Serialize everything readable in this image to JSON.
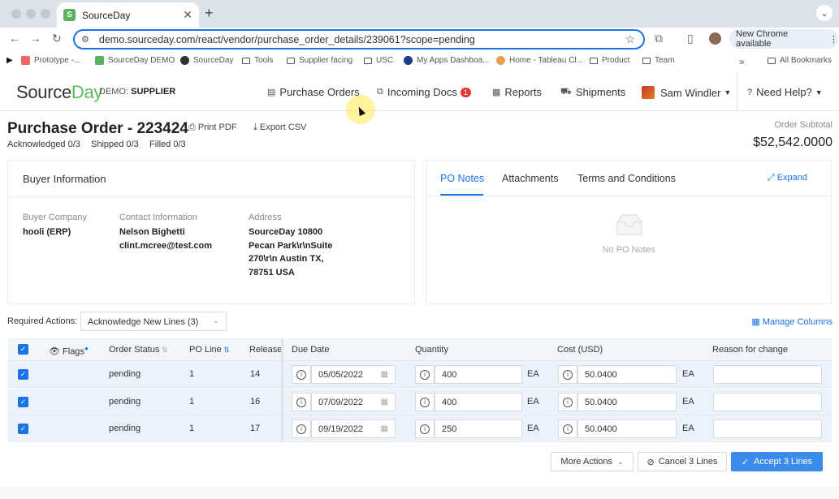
{
  "browser": {
    "tab_title": "SourceDay",
    "url": "demo.sourceday.com/react/vendor/purchase_order_details/239061?scope=pending",
    "new_chrome": "New Chrome available",
    "bookmarks": [
      "Prototype -...",
      "SourceDay DEMO",
      "SourceDay",
      "Tools",
      "Supplier facing",
      "USC",
      "My Apps Dashboa...",
      "Home - Tableau Cl...",
      "Product",
      "Team"
    ],
    "all_bookmarks": "All Bookmarks"
  },
  "app": {
    "logo_source": "Source",
    "logo_day": "Day",
    "demo_prefix": "DEMO: ",
    "demo_role": "SUPPLIER",
    "nav": {
      "purchase_orders": "Purchase Orders",
      "incoming_docs": "Incoming Docs",
      "incoming_badge": "1",
      "reports": "Reports",
      "shipments": "Shipments",
      "user": "Sam Windler",
      "help": "Need Help?"
    }
  },
  "po": {
    "title": "Purchase Order - 223424",
    "print": "Print PDF",
    "export": "Export CSV",
    "acknowledged": "Acknowledged 0/3",
    "shipped": "Shipped 0/3",
    "filled": "Filled 0/3",
    "subtotal_label": "Order Subtotal",
    "subtotal": "$52,542.0000"
  },
  "buyer": {
    "header": "Buyer Information",
    "company_label": "Buyer Company",
    "company": "hooli (ERP)",
    "contact_label": "Contact Information",
    "contact_name": "Nelson Bighetti",
    "contact_email": "clint.mcree@test.com",
    "address_label": "Address",
    "address_lines": [
      "SourceDay 10800",
      "Pecan Park\\r\\nSuite",
      "270\\r\\n Austin TX,",
      "78751 USA"
    ]
  },
  "notes": {
    "tabs": [
      "PO Notes",
      "Attachments",
      "Terms and Conditions"
    ],
    "expand": "Expand",
    "empty": "No PO Notes"
  },
  "actions": {
    "required_label": "Required Actions:",
    "required_value": "Acknowledge New Lines (3)",
    "manage_columns": "Manage Columns"
  },
  "table": {
    "headers": {
      "flags": "Flags",
      "order_status": "Order Status",
      "po_line": "PO Line",
      "release": "Release",
      "due_date": "Due Date",
      "quantity": "Quantity",
      "cost": "Cost (USD)",
      "reason": "Reason for change"
    },
    "rows": [
      {
        "status": "pending",
        "line": "1",
        "release": "14",
        "due": "05/05/2022",
        "qty": "400",
        "qty_unit": "EA",
        "cost": "50.0400",
        "cost_unit": "EA"
      },
      {
        "status": "pending",
        "line": "1",
        "release": "16",
        "due": "07/09/2022",
        "qty": "400",
        "qty_unit": "EA",
        "cost": "50.0400",
        "cost_unit": "EA"
      },
      {
        "status": "pending",
        "line": "1",
        "release": "17",
        "due": "09/19/2022",
        "qty": "250",
        "qty_unit": "EA",
        "cost": "50.0400",
        "cost_unit": "EA"
      }
    ]
  },
  "buttons": {
    "more_actions": "More Actions",
    "cancel": "Cancel 3 Lines",
    "accept": "Accept 3 Lines"
  }
}
